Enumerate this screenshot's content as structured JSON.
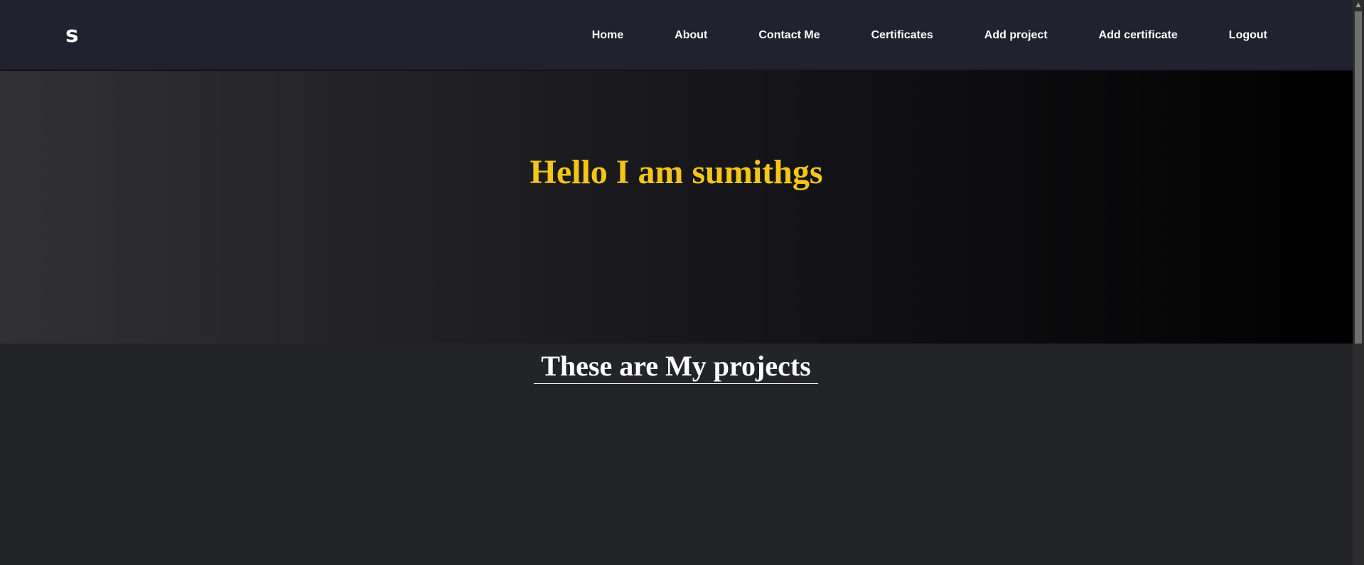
{
  "navbar": {
    "logo": "s",
    "links": [
      {
        "label": "Home"
      },
      {
        "label": "About"
      },
      {
        "label": "Contact Me"
      },
      {
        "label": "Certificates"
      },
      {
        "label": "Add project"
      },
      {
        "label": "Add certificate"
      },
      {
        "label": "Logout"
      }
    ]
  },
  "hero": {
    "title": "Hello I am sumithgs"
  },
  "projects": {
    "title": "These are My projects"
  },
  "scrollbar": {
    "up_arrow": "▲"
  },
  "colors": {
    "accent": "#f5c518",
    "navbar_bg": "#202230",
    "page_bg": "#232427"
  }
}
